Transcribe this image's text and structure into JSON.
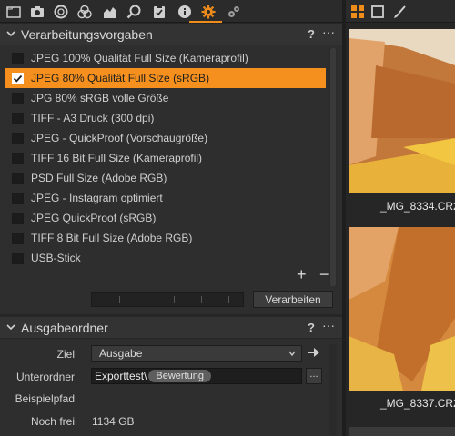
{
  "toolbar": {
    "icons": [
      "library-icon",
      "camera-icon",
      "lens-icon",
      "color-icon",
      "exposure-icon",
      "details-icon",
      "adjustments-icon",
      "metadata-icon",
      "output-icon",
      "batch-icon"
    ]
  },
  "recipes_panel": {
    "title": "Verarbeitungsvorgaben",
    "help": "?",
    "menu": "···",
    "items": [
      {
        "label": "JPEG 100% Qualität Full Size (Kameraprofil)",
        "checked": false
      },
      {
        "label": "JPEG 80% Qualität Full Size (sRGB)",
        "checked": true
      },
      {
        "label": "JPG 80% sRGB volle Größe",
        "checked": false
      },
      {
        "label": "TIFF - A3 Druck (300 dpi)",
        "checked": false
      },
      {
        "label": "JPEG - QuickProof (Vorschaugröße)",
        "checked": false
      },
      {
        "label": "TIFF 16 Bit Full Size (Kameraprofil)",
        "checked": false
      },
      {
        "label": "PSD Full Size (Adobe RGB)",
        "checked": false
      },
      {
        "label": "JPEG - Instagram optimiert",
        "checked": false
      },
      {
        "label": "JPEG QuickProof (sRGB)",
        "checked": false
      },
      {
        "label": "TIFF 8 Bit Full Size (Adobe RGB)",
        "checked": false
      },
      {
        "label": "USB-Stick",
        "checked": false
      }
    ],
    "plus": "+",
    "minus": "−",
    "process_button": "Verarbeiten"
  },
  "output_panel": {
    "title": "Ausgabeordner",
    "help": "?",
    "menu": "···",
    "ziel_label": "Ziel",
    "ziel_value": "Ausgabe",
    "unterordner_label": "Unterordner",
    "unterordner_value": "Exporttest\\",
    "token": "Bewertung",
    "browse": "...",
    "beispielpfad_label": "Beispielpfad",
    "nochfrei_label": "Noch frei",
    "nochfrei_value": "1134 GB"
  },
  "browser": {
    "thumbnails": [
      {
        "caption": "_MG_8334.CR2"
      },
      {
        "caption": "_MG_8337.CR2"
      }
    ]
  },
  "colors": {
    "accent": "#f5901e"
  }
}
